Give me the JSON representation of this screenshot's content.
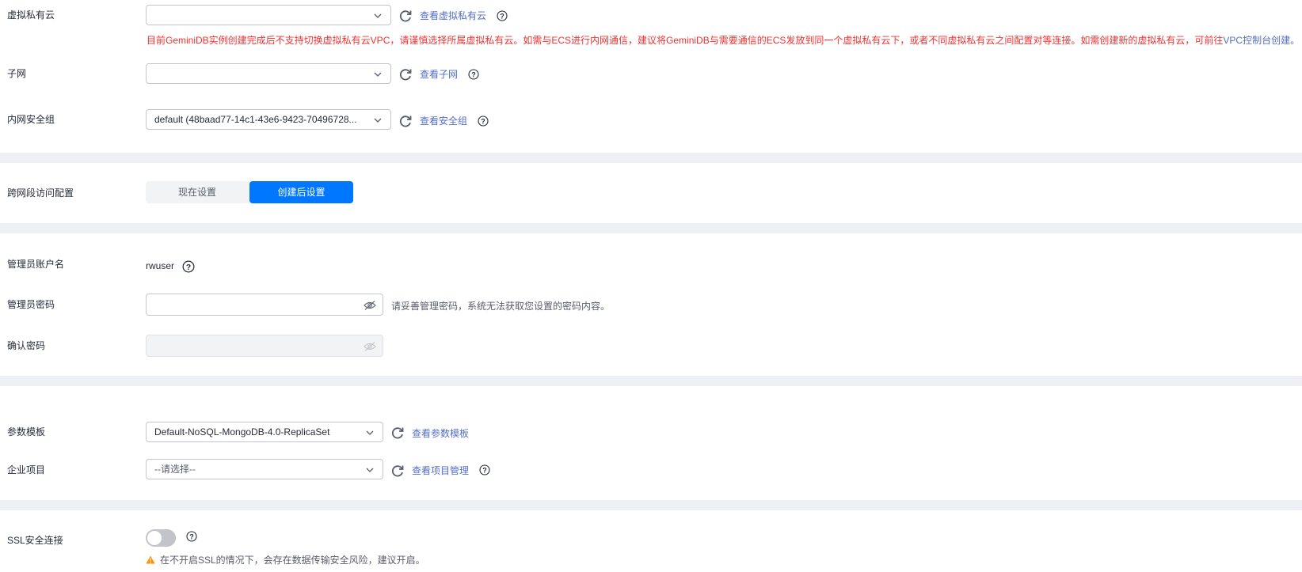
{
  "network": {
    "vpc": {
      "label": "虚拟私有云",
      "value": "",
      "link": "查看虚拟私有云",
      "warning": "目前GeminiDB实例创建完成后不支持切换虚拟私有云VPC，请谨慎选择所属虚拟私有云。如需与ECS进行内网通信，建议将GeminiDB与需要通信的ECS发放到同一个虚拟私有云下，或者不同虚拟私有云之间配置对等连接。如需创建新的虚拟私有云，可前往",
      "warning_link": "VPC控制台创建。"
    },
    "subnet": {
      "label": "子网",
      "value": "",
      "link": "查看子网"
    },
    "security_group": {
      "label": "内网安全组",
      "value": "default (48baad77-14c1-43e6-9423-70496728...",
      "link": "查看安全组"
    }
  },
  "cross_segment": {
    "label": "跨网段访问配置",
    "options": [
      "现在设置",
      "创建后设置"
    ],
    "selected": "创建后设置"
  },
  "admin": {
    "account_label": "管理员账户名",
    "account_value": "rwuser",
    "password_label": "管理员密码",
    "password_hint": "请妥善管理密码，系统无法获取您设置的密码内容。",
    "confirm_label": "确认密码"
  },
  "params": {
    "template_label": "参数模板",
    "template_value": "Default-NoSQL-MongoDB-4.0-ReplicaSet",
    "template_link": "查看参数模板",
    "project_label": "企业项目",
    "project_placeholder": "--请选择--",
    "project_link": "查看项目管理"
  },
  "ssl": {
    "label": "SSL安全连接",
    "enabled": false,
    "warning": "在不开启SSL的情况下，会存在数据传输安全风险，建议开启。"
  },
  "colors": {
    "accent": "#0077ff",
    "link": "#526ecc",
    "danger": "#f23030",
    "warning": "#ff9000",
    "band": "#eef0f5"
  },
  "icons": [
    "chevron-down-icon",
    "refresh-icon",
    "help-icon",
    "eye-hidden-icon",
    "warning-triangle-icon"
  ]
}
